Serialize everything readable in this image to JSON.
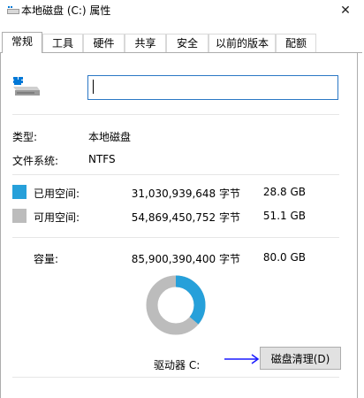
{
  "window": {
    "title": "本地磁盘 (C:) 属性",
    "close_glyph": "✕"
  },
  "tabs": [
    {
      "label": "常规",
      "active": true
    },
    {
      "label": "工具"
    },
    {
      "label": "硬件"
    },
    {
      "label": "共享"
    },
    {
      "label": "安全"
    },
    {
      "label": "以前的版本"
    },
    {
      "label": "配额"
    }
  ],
  "general": {
    "drive_name_value": "",
    "type_label": "类型:",
    "type_value": "本地磁盘",
    "fs_label": "文件系统:",
    "fs_value": "NTFS",
    "used": {
      "label": "已用空间:",
      "bytes": "31,030,939,648 字节",
      "size": "28.8 GB",
      "color": "#26a0da"
    },
    "free": {
      "label": "可用空间:",
      "bytes": "54,869,450,752 字节",
      "size": "51.1 GB",
      "color": "#bcbcbc"
    },
    "capacity": {
      "label": "容量:",
      "bytes": "85,900,390,400 字节",
      "size": "80.0 GB"
    },
    "used_fraction": 0.361,
    "drive_label": "驱动器 C:",
    "cleanup_button": "磁盘清理(D)"
  },
  "annotation": {
    "arrow_color": "#1a1aff"
  }
}
